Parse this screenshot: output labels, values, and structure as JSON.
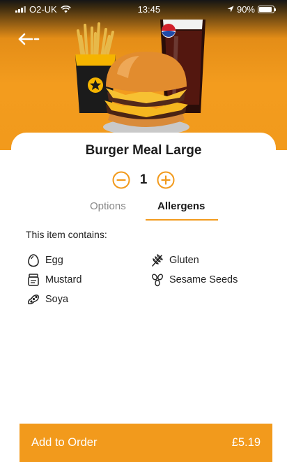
{
  "status_bar": {
    "carrier": "O2-UK",
    "time": "13:45",
    "battery": "90%"
  },
  "item": {
    "title": "Burger Meal Large",
    "quantity": "1"
  },
  "tabs": [
    {
      "label": "Options",
      "active": false
    },
    {
      "label": "Allergens",
      "active": true
    }
  ],
  "allergens_section": {
    "heading": "This item contains:",
    "items": [
      {
        "label": "Egg",
        "icon": "egg-icon"
      },
      {
        "label": "Gluten",
        "icon": "wheat-icon"
      },
      {
        "label": "Mustard",
        "icon": "mustard-jar-icon"
      },
      {
        "label": "Sesame Seeds",
        "icon": "sesame-icon"
      },
      {
        "label": "Soya",
        "icon": "soya-icon"
      }
    ]
  },
  "footer": {
    "cta_label": "Add to Order",
    "price": "£5.19"
  },
  "brand_logo_text": "pepsi",
  "colors": {
    "accent": "#f29a1c"
  }
}
